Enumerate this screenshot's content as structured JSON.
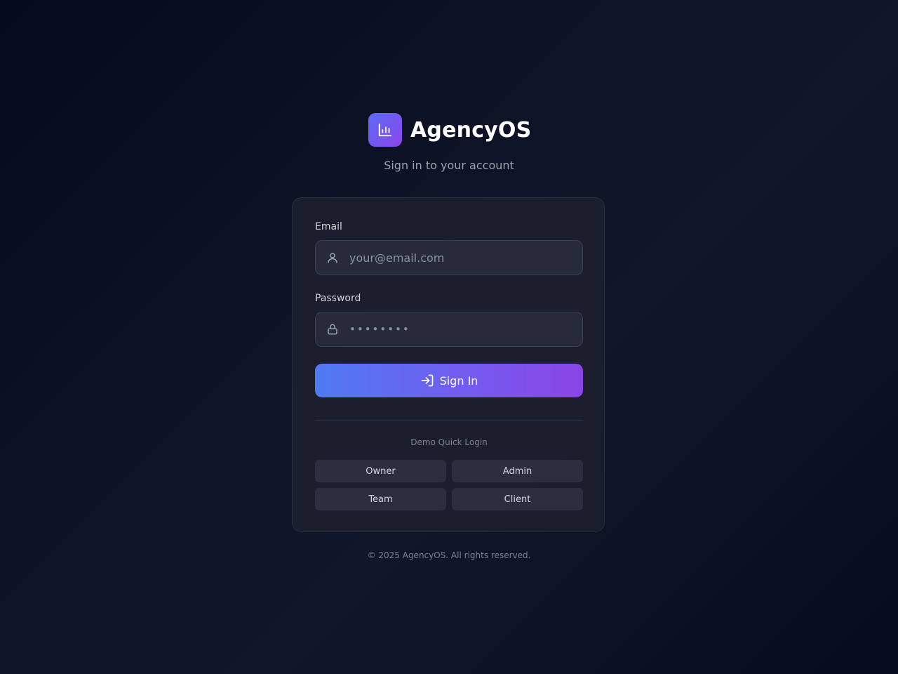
{
  "brand": {
    "name": "AgencyOS",
    "logo_icon": "bar-chart-icon",
    "logo_gradient": [
      "#5b6cf5",
      "#8b45ea"
    ]
  },
  "subtitle": "Sign in to your account",
  "form": {
    "email_label": "Email",
    "email_placeholder": "your@email.com",
    "email_icon": "user-icon",
    "password_label": "Password",
    "password_value": "••••••••",
    "password_icon": "lock-icon",
    "submit_label": "Sign In",
    "submit_icon": "log-in-icon",
    "submit_gradient": [
      "#4f7af3",
      "#8a45e6"
    ]
  },
  "demo": {
    "title": "Demo Quick Login",
    "buttons": [
      "Owner",
      "Admin",
      "Team",
      "Client"
    ]
  },
  "footer": "© 2025 AgencyOS. All rights reserved.",
  "colors": {
    "background": "#0b1022",
    "card": "#1c202e",
    "input": "#262a3a"
  }
}
